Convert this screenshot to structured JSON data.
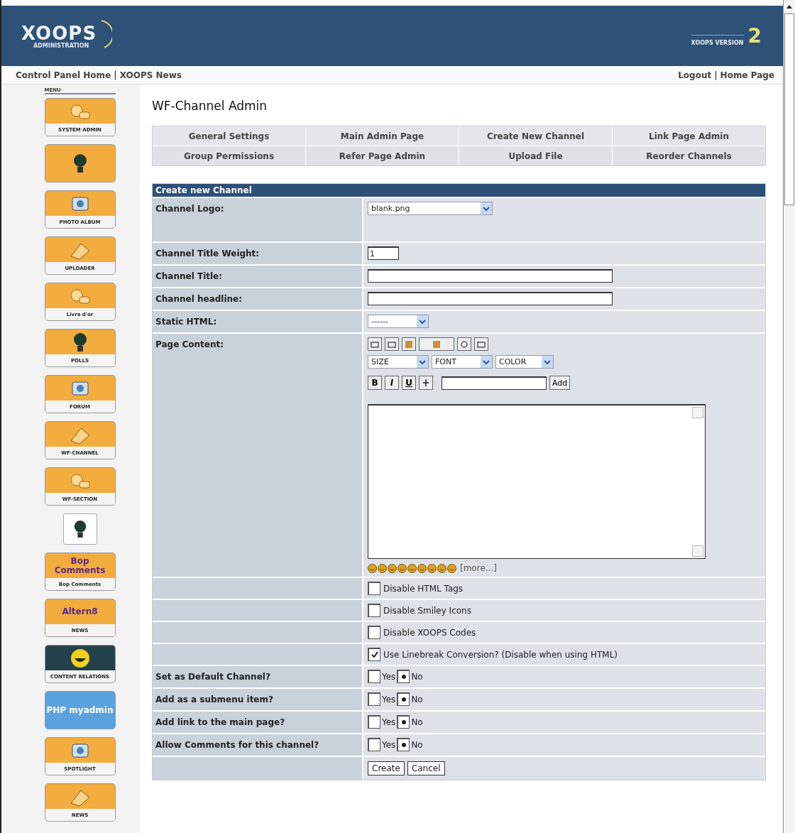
{
  "header": {
    "logo": "XOOPS",
    "logo_sub": "ADMINISTRATION",
    "version_label": "XOOPS VERSION",
    "version": "2"
  },
  "nav": {
    "separator": "|",
    "left": [
      "Control Panel Home",
      "XOOPS News"
    ],
    "right": [
      "Logout",
      "Home Page"
    ]
  },
  "sidebar": {
    "title": "MENU",
    "modules": [
      {
        "kind": "tile",
        "label": "SYSTEM ADMIN"
      },
      {
        "kind": "tile"
      },
      {
        "kind": "tile",
        "label": "PHOTO ALBUM"
      },
      {
        "kind": "tile",
        "label": "UPLOADER"
      },
      {
        "kind": "tile",
        "label": "Livre d'or"
      },
      {
        "kind": "tile",
        "label": "POLLS"
      },
      {
        "kind": "tile",
        "label": "FORUM"
      },
      {
        "kind": "tile",
        "label": "WF-CHANNEL"
      },
      {
        "kind": "tile",
        "label": "WF-SECTION"
      },
      {
        "kind": "plain"
      },
      {
        "kind": "tile",
        "title": "Bop Comments",
        "label": "Bop Comments"
      },
      {
        "kind": "tile",
        "title": "Altern8",
        "label": "NEWS"
      },
      {
        "kind": "dark",
        "label": "CONTENT RELATIONS"
      },
      {
        "kind": "blue",
        "title": "PHP myadmin"
      },
      {
        "kind": "tile",
        "label": "SPOTLIGHT"
      },
      {
        "kind": "tile",
        "label": "NEWS"
      }
    ]
  },
  "page_title": "WF-Channel Admin",
  "admin_menu": [
    [
      "General Settings",
      "Main Admin Page",
      "Create New Channel",
      "Link Page Admin"
    ],
    [
      "Group Permissions",
      "Refer Page Admin",
      "Upload File",
      "Reorder Channels"
    ]
  ],
  "form": {
    "title": "Create new Channel",
    "rows": [
      {
        "kind": "select",
        "label": "Channel Logo:",
        "value": "blank.png"
      },
      {
        "kind": "short_text",
        "label": "Channel Title Weight:",
        "value": "1"
      },
      {
        "kind": "text",
        "label": "Channel Title:"
      },
      {
        "kind": "text",
        "label": "Channel headline:"
      },
      {
        "kind": "small_select",
        "label": "Static HTML:",
        "value": "------"
      },
      {
        "kind": "editor",
        "label": "Page Content:",
        "selects": [
          "SIZE",
          "FONT",
          "COLOR"
        ],
        "format_buttons": [
          "B",
          "I",
          "U"
        ],
        "add_button": "Add",
        "more_link": "[more...]"
      },
      {
        "kind": "checkbox",
        "text": "Disable HTML Tags",
        "checked": false
      },
      {
        "kind": "checkbox",
        "text": "Disable Smiley Icons",
        "checked": false
      },
      {
        "kind": "checkbox",
        "text": "Disable XOOPS Codes",
        "checked": false
      },
      {
        "kind": "checkbox",
        "text": "Use Linebreak Conversion? (Disable when using HTML)",
        "checked": true
      },
      {
        "kind": "radio",
        "label": "Set as Default Channel?",
        "options": [
          {
            "text": "Yes",
            "selected": false
          },
          {
            "text": "No",
            "selected": true
          }
        ]
      },
      {
        "kind": "radio",
        "label": "Add as a submenu item?",
        "options": [
          {
            "text": "Yes",
            "selected": false
          },
          {
            "text": "No",
            "selected": true
          }
        ]
      },
      {
        "kind": "radio",
        "label": "Add link to the main page?",
        "options": [
          {
            "text": "Yes",
            "selected": false
          },
          {
            "text": "No",
            "selected": true
          }
        ]
      },
      {
        "kind": "radio",
        "label": "Allow Comments for this channel?",
        "options": [
          {
            "text": "Yes",
            "selected": false
          },
          {
            "text": "No",
            "selected": true
          }
        ]
      },
      {
        "kind": "buttons",
        "buttons": [
          "Create",
          "Cancel"
        ]
      }
    ]
  }
}
